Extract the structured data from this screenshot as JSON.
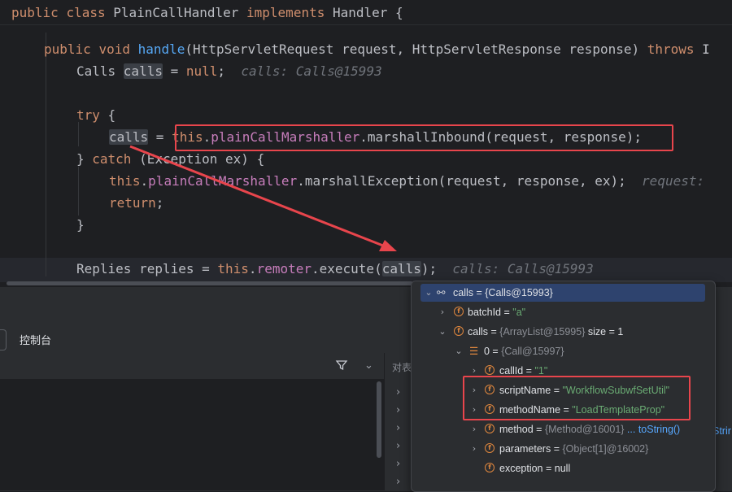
{
  "code": {
    "line1": {
      "kw1": "public",
      "kw2": "class",
      "name": "PlainCallHandler",
      "kw3": "implements",
      "rest": "Handler {"
    },
    "line2": {
      "kw1": "public",
      "kw2": "void",
      "fn": "handle",
      "rest": "(HttpServletRequest request, HttpServletResponse response) ",
      "kw3": "throws",
      "tail": " I"
    },
    "line3": {
      "pre": "Calls ",
      "var": "calls",
      "mid": " = ",
      "kw": "null",
      "end": ";",
      "hint": "calls: Calls@15993"
    },
    "line4": {
      "kw": "try",
      "rest": " {"
    },
    "line5": {
      "var": "calls",
      "mid": " = ",
      "kw": "this",
      "dot": ".",
      "fld": "plainCallMarshaller",
      "fn": ".marshallInbound",
      "rest": "(request, response);"
    },
    "line6": {
      "pre": "} ",
      "kw": "catch",
      "rest": " (Exception ex) {"
    },
    "line7": {
      "kw": "this",
      "dot": ".",
      "fld": "plainCallMarshaller",
      "rest": ".marshallException(request, response, ex);",
      "hint": "request:"
    },
    "line8": {
      "kw": "return",
      "rest": ";"
    },
    "line9": {
      "text": "}"
    },
    "line10": {
      "pre": "Replies replies = ",
      "kw": "this",
      "dot": ".",
      "fld": "remoter",
      "rest": ".execute(",
      "var": "calls",
      "end": ");",
      "hint": "calls: Calls@15993"
    }
  },
  "panel": {
    "tab_label": "控制台",
    "right_header": "对表"
  },
  "debug_popup": {
    "root": "calls = {Calls@15993}",
    "items": [
      {
        "name": "batchId",
        "eq": " = ",
        "value": "\"a\""
      },
      {
        "name": "calls",
        "eq": " = ",
        "value": "{ArrayList@15995}",
        "extra": "  size = 1"
      },
      {
        "name": "0",
        "eq": " = ",
        "value": "{Call@15997}"
      },
      {
        "name": "callId",
        "eq": " = ",
        "value": "\"1\""
      },
      {
        "name": "scriptName",
        "eq": " = ",
        "value": "\"WorkflowSubwfSetUtil\""
      },
      {
        "name": "methodName",
        "eq": " = ",
        "value": "\"LoadTemplateProp\""
      },
      {
        "name": "method",
        "eq": " = ",
        "value": "{Method@16001}",
        "extra": " ... toString()"
      },
      {
        "name": "parameters",
        "eq": " = ",
        "value": "{Object[1]@16002}"
      },
      {
        "name": "exception",
        "eq": " = ",
        "value": "null"
      }
    ],
    "edge_text": "Strir"
  },
  "colors": {
    "annotation": "#e8454c",
    "selection": "#2e436e"
  }
}
